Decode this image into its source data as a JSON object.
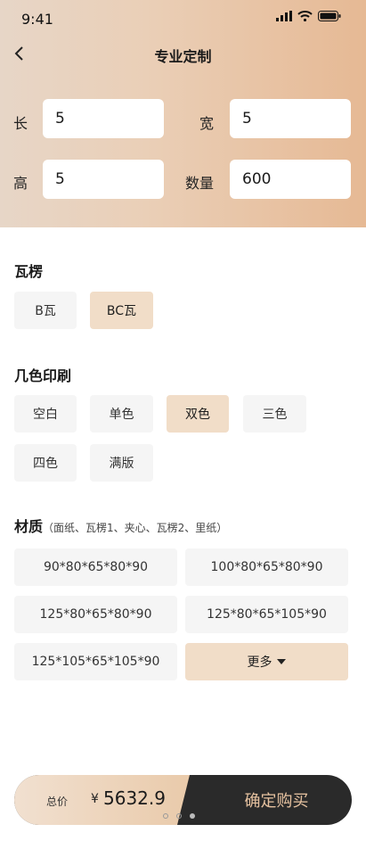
{
  "status_bar": {
    "time": "9:41"
  },
  "header": {
    "title": "专业定制"
  },
  "dimensions": {
    "length": {
      "label": "长",
      "value": "5"
    },
    "width": {
      "label": "宽",
      "value": "5"
    },
    "height": {
      "label": "高",
      "value": "5"
    },
    "quantity": {
      "label": "数量",
      "value": "600"
    }
  },
  "flute": {
    "title": "瓦楞",
    "options": [
      "B瓦",
      "BC瓦"
    ],
    "selected": "BC瓦"
  },
  "printing": {
    "title": "几色印刷",
    "options": [
      "空白",
      "单色",
      "双色",
      "三色",
      "四色",
      "满版"
    ],
    "selected": "双色"
  },
  "material": {
    "title": "材质",
    "subtitle": "（面纸、瓦楞1、夹心、瓦楞2、里纸）",
    "options": [
      "90*80*65*80*90",
      "100*80*65*80*90",
      "125*80*65*80*90",
      "125*80*65*105*90",
      "125*105*65*105*90"
    ],
    "more_label": "更多"
  },
  "bottom": {
    "price_label": "总价",
    "currency": "¥",
    "price": "5632.9",
    "buy_label": "确定购买"
  },
  "colors": {
    "accent": "#f1ddc8",
    "header_start": "#e7d6c7",
    "header_end": "#e6b994",
    "buy_bg": "#2a2a2a",
    "buy_text": "#e6c2a0"
  },
  "icons": [
    "signal-icon",
    "wifi-icon",
    "battery-icon",
    "back-chevron-icon",
    "caret-down-icon"
  ]
}
